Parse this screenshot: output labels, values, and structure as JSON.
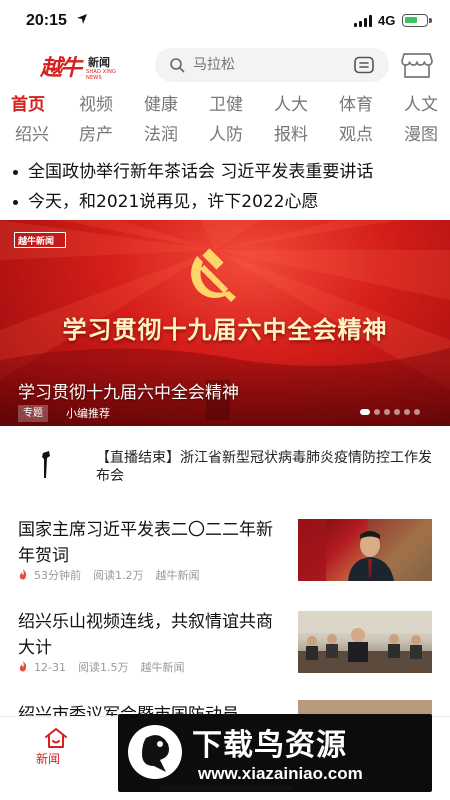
{
  "status_bar": {
    "time": "20:15",
    "network": "4G"
  },
  "header": {
    "logo_main": "越牛",
    "logo_sub": "新闻",
    "logo_en": "SHAO XING NEWS",
    "search_placeholder": "马拉松"
  },
  "categories_row1": [
    "首页",
    "视频",
    "健康",
    "卫健",
    "人大",
    "体育",
    "人文"
  ],
  "categories_row2": [
    "绍兴",
    "房产",
    "法润",
    "人防",
    "报料",
    "观点",
    "漫图"
  ],
  "headlines": [
    "全国政协举行新年茶话会  习近平发表重要讲话",
    "今天，和2021说再见，许下2022心愿"
  ],
  "banner": {
    "logo": "越牛新闻",
    "title": "学习贯彻十九届六中全会精神",
    "caption": "学习贯彻十九届六中全会精神",
    "tag": "专题",
    "author": "小编推荐",
    "slide_count": 6,
    "active_slide": 0
  },
  "live_notice": "【直播结束】浙江省新型冠状病毒肺炎疫情防控工作发布会",
  "news": [
    {
      "title": "国家主席习近平发表二〇二二年新年贺词",
      "time": "53分钟前",
      "reads": "阅读1.2万",
      "source": "越牛新闻"
    },
    {
      "title": "绍兴乐山视频连线，共叙情谊共商大计",
      "time": "12-31",
      "reads": "阅读1.5万",
      "source": "越牛新闻"
    }
  ],
  "news3_title": "绍兴市委议军会暨市国防动员",
  "tab_bar": {
    "home_label": "新闻"
  },
  "watermark": {
    "main": "下载鸟资源",
    "url": "www.xiazainiao.com"
  },
  "colors": {
    "accent": "#d6201b",
    "banner": "#c81a18"
  }
}
